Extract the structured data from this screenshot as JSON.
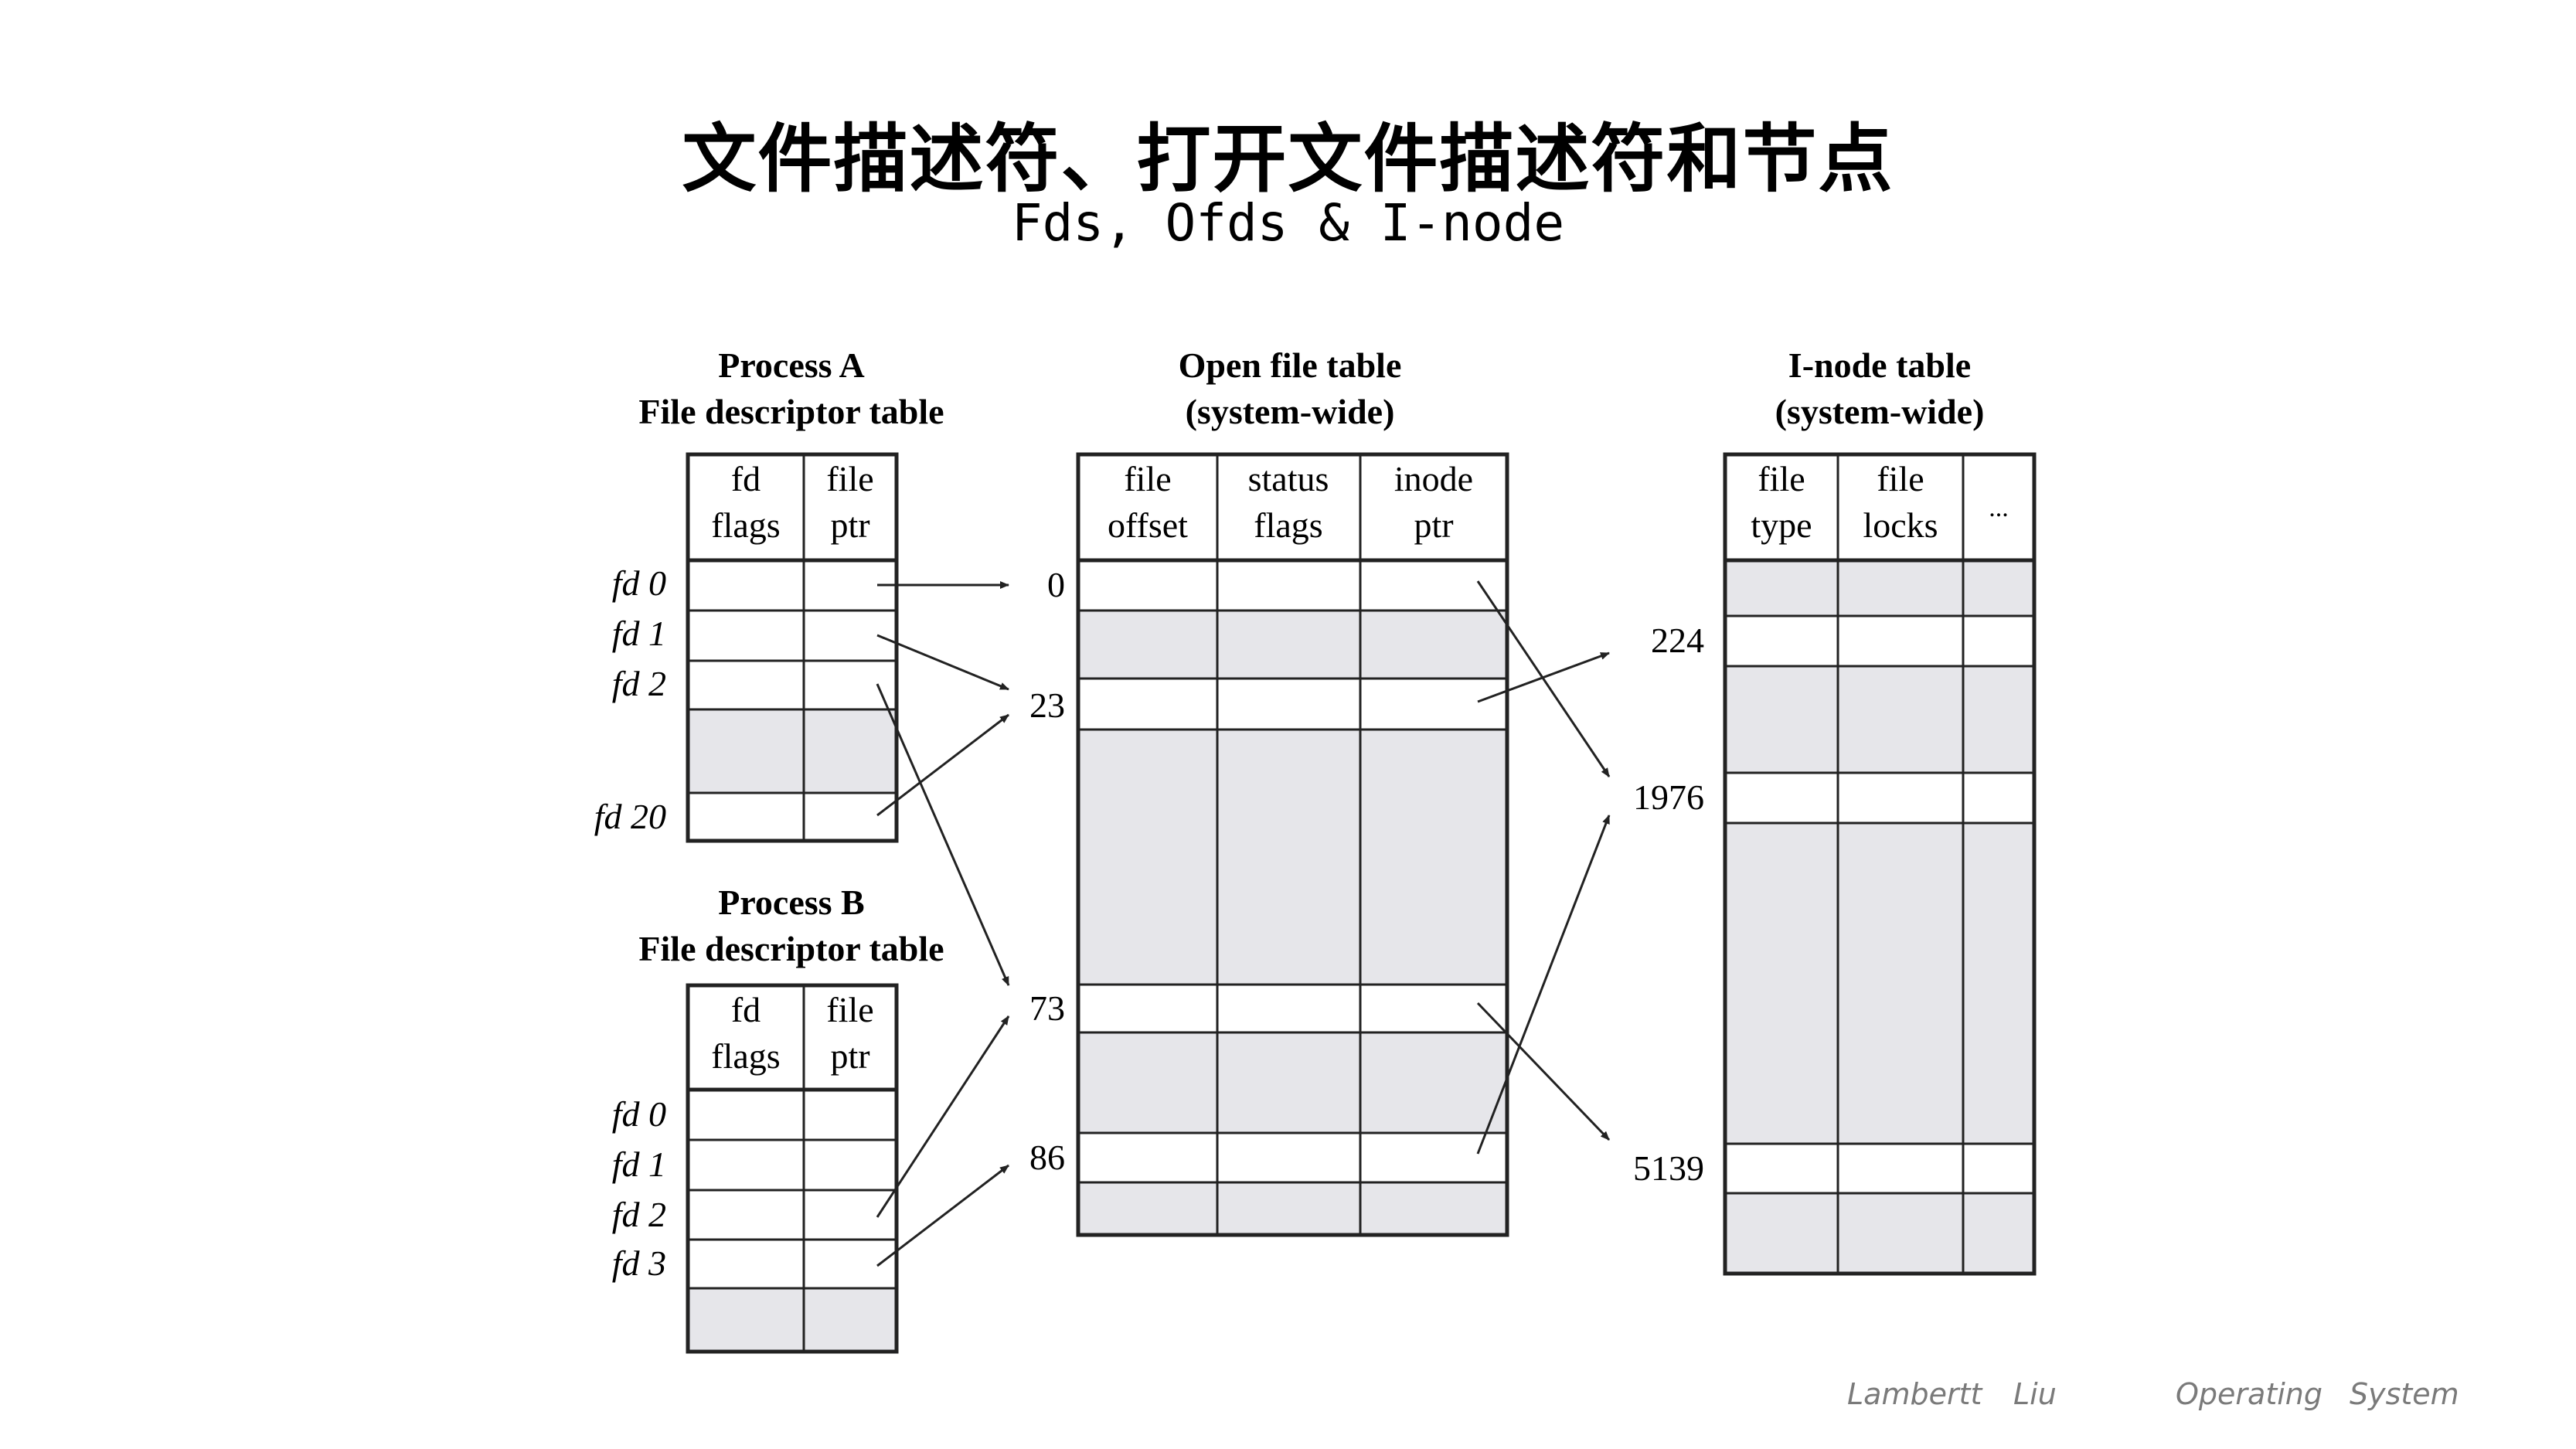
{
  "title": "文件描述符、打开文件描述符和节点",
  "subtitle": "Fds, Ofds & I-node",
  "process_a": {
    "heading_line1": "Process A",
    "heading_line2": "File descriptor table",
    "col1": [
      "fd",
      "flags"
    ],
    "col2": [
      "file",
      "ptr"
    ],
    "fds": [
      "fd 0",
      "fd 1",
      "fd 2",
      "fd 20"
    ]
  },
  "process_b": {
    "heading_line1": "Process B",
    "heading_line2": "File descriptor table",
    "col1": [
      "fd",
      "flags"
    ],
    "col2": [
      "file",
      "ptr"
    ],
    "fds": [
      "fd 0",
      "fd 1",
      "fd 2",
      "fd 3"
    ]
  },
  "open_file_table": {
    "heading_line1": "Open file table",
    "heading_line2": "(system-wide)",
    "col1": [
      "file",
      "offset"
    ],
    "col2": [
      "status",
      "flags"
    ],
    "col3": [
      "inode",
      "ptr"
    ],
    "indices": [
      "0",
      "23",
      "73",
      "86"
    ]
  },
  "inode_table": {
    "heading_line1": "I-node table",
    "heading_line2": "(system-wide)",
    "col1": [
      "file",
      "type"
    ],
    "col2": [
      "file",
      "locks"
    ],
    "col3": "...",
    "indices": [
      "224",
      "1976",
      "5139"
    ]
  },
  "footer": {
    "author_first": "Lambertt",
    "author_last": "Liu",
    "course_1": "Operating",
    "course_2": "System"
  },
  "colors": {
    "shaded": "#e6e6ea",
    "line": "#222222"
  }
}
